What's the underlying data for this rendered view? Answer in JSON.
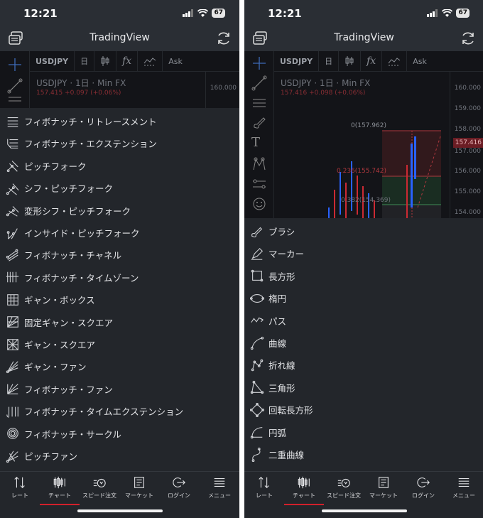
{
  "status": {
    "time": "12:21",
    "battery": "67"
  },
  "app": {
    "title": "TradingView"
  },
  "chart_toolbar": {
    "symbol": "USDJPY",
    "interval": "日",
    "ask": "Ask"
  },
  "left_screen": {
    "legend": {
      "symbol": "USDJPY",
      "interval": "1日",
      "source": "Min FX",
      "ohlc": "157.415 +0.097 (+0.06%)"
    },
    "price_axis": [
      "160.000"
    ],
    "menu": [
      {
        "label": "フィボナッチ・リトレースメント",
        "icon": "fib-retracement-icon"
      },
      {
        "label": "フィボナッチ・エクステンション",
        "icon": "fib-extension-icon"
      },
      {
        "label": "ピッチフォーク",
        "icon": "pitchfork-icon"
      },
      {
        "label": "シフ・ピッチフォーク",
        "icon": "schiff-pitchfork-icon"
      },
      {
        "label": "変形シフ・ピッチフォーク",
        "icon": "modified-schiff-icon"
      },
      {
        "label": "インサイド・ピッチフォーク",
        "icon": "inside-pitchfork-icon"
      },
      {
        "label": "フィボナッチ・チャネル",
        "icon": "fib-channel-icon"
      },
      {
        "label": "フィボナッチ・タイムゾーン",
        "icon": "fib-timezone-icon"
      },
      {
        "label": "ギャン・ボックス",
        "icon": "gann-box-icon"
      },
      {
        "label": "固定ギャン・スクエア",
        "icon": "gann-square-fixed-icon"
      },
      {
        "label": "ギャン・スクエア",
        "icon": "gann-square-icon"
      },
      {
        "label": "ギャン・ファン",
        "icon": "gann-fan-icon"
      },
      {
        "label": "フィボナッチ・ファン",
        "icon": "fib-fan-icon"
      },
      {
        "label": "フィボナッチ・タイムエクステンション",
        "icon": "fib-time-extension-icon"
      },
      {
        "label": "フィボナッチ・サークル",
        "icon": "fib-circle-icon"
      },
      {
        "label": "ピッチファン",
        "icon": "pitchfan-icon"
      }
    ]
  },
  "right_screen": {
    "legend": {
      "symbol": "USDJPY",
      "interval": "1日",
      "source": "Min FX",
      "ohlc": "157.416 +0.098 (+0.06%)"
    },
    "price_axis": [
      "160.000",
      "159.000",
      "158.000",
      "157.000",
      "156.000",
      "155.000",
      "154.000"
    ],
    "price_tag": "157.416",
    "fib_labels": [
      "0(157.962)",
      "0.236(155.742)",
      "0.382(154.369)"
    ],
    "menu": [
      {
        "label": "ブラシ",
        "icon": "brush-icon"
      },
      {
        "label": "マーカー",
        "icon": "marker-icon"
      },
      {
        "label": "長方形",
        "icon": "rectangle-icon"
      },
      {
        "label": "楕円",
        "icon": "ellipse-icon"
      },
      {
        "label": "パス",
        "icon": "path-icon"
      },
      {
        "label": "曲線",
        "icon": "curve-icon"
      },
      {
        "label": "折れ線",
        "icon": "polyline-icon"
      },
      {
        "label": "三角形",
        "icon": "triangle-icon"
      },
      {
        "label": "回転長方形",
        "icon": "rotated-rectangle-icon"
      },
      {
        "label": "円弧",
        "icon": "arc-icon"
      },
      {
        "label": "二重曲線",
        "icon": "double-curve-icon"
      }
    ]
  },
  "bottom_nav": [
    {
      "label": "レート",
      "icon": "rate-icon",
      "active": false
    },
    {
      "label": "チャート",
      "icon": "chart-icon",
      "active": true
    },
    {
      "label": "スピード注文",
      "icon": "speed-order-icon",
      "active": false
    },
    {
      "label": "マーケット",
      "icon": "market-icon",
      "active": false
    },
    {
      "label": "ログイン",
      "icon": "login-icon",
      "active": false
    },
    {
      "label": "メニュー",
      "icon": "menu-icon",
      "active": false
    }
  ],
  "colors": {
    "accent": "#d2202b",
    "background": "#1b1d21",
    "sheet": "#23262b"
  }
}
